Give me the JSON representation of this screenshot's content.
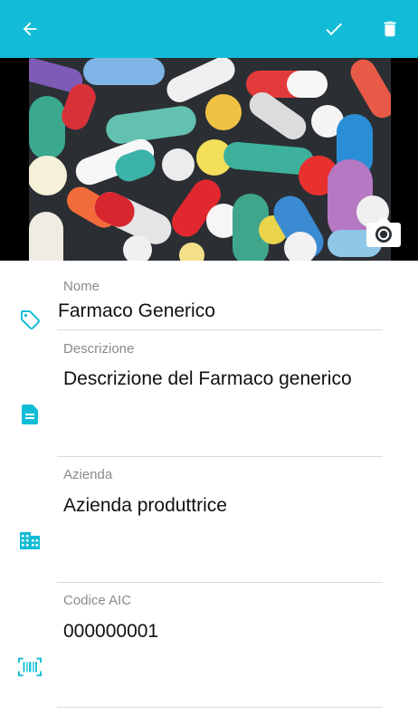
{
  "appbar": {
    "color": "#13BCD6",
    "back_icon": "arrow-back-icon",
    "confirm_icon": "checkmark-icon",
    "delete_icon": "trash-icon"
  },
  "photo": {
    "subject": "colorful pills and capsules",
    "camera_icon": "camera-icon"
  },
  "fields": {
    "nome": {
      "label": "Nome",
      "value": "Farmaco Generico",
      "icon": "tag-icon"
    },
    "descrizione": {
      "label": "Descrizione",
      "value": "Descrizione del Farmaco generico",
      "icon": "document-icon"
    },
    "azienda": {
      "label": "Azienda",
      "value": "Azienda produttrice",
      "icon": "building-icon"
    },
    "codice_aic": {
      "label": "Codice AIC",
      "value": "000000001",
      "icon": "barcode-icon"
    }
  },
  "colors": {
    "accent": "#13BCD6",
    "label": "#8a8a8a",
    "divider": "#d9d9d9"
  }
}
